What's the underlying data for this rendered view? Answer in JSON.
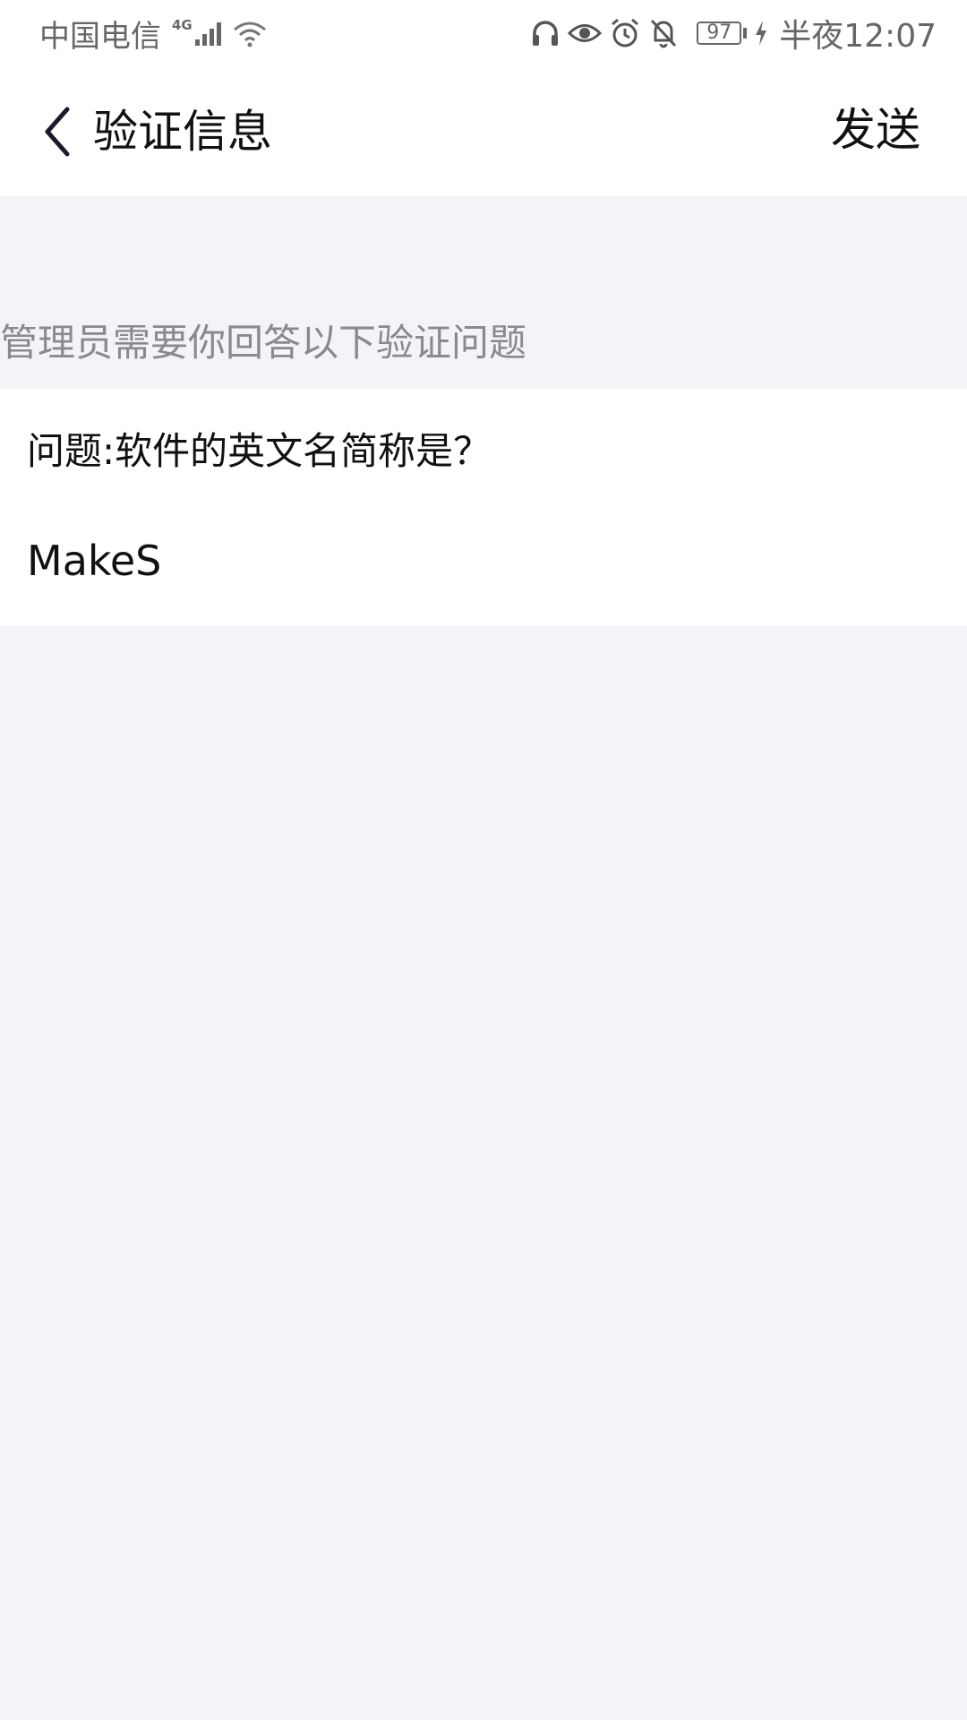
{
  "status_bar": {
    "carrier": "中国电信",
    "network_type": "4G",
    "battery_level": "97",
    "time": "半夜12:07",
    "icons": [
      "signal-icon",
      "wifi-icon",
      "headphones-icon",
      "eye-icon",
      "alarm-icon",
      "bell-off-icon",
      "battery-icon",
      "charging-icon"
    ]
  },
  "header": {
    "title": "验证信息",
    "send_label": "发送"
  },
  "verification": {
    "hint": "管理员需要你回答以下验证问题",
    "question": "问题:软件的英文名简称是？",
    "answer_value": "MakeS"
  },
  "colors": {
    "background": "#f3f4f8",
    "card": "#ffffff",
    "hint_text": "#8a8a8e",
    "status_text": "#666666"
  }
}
